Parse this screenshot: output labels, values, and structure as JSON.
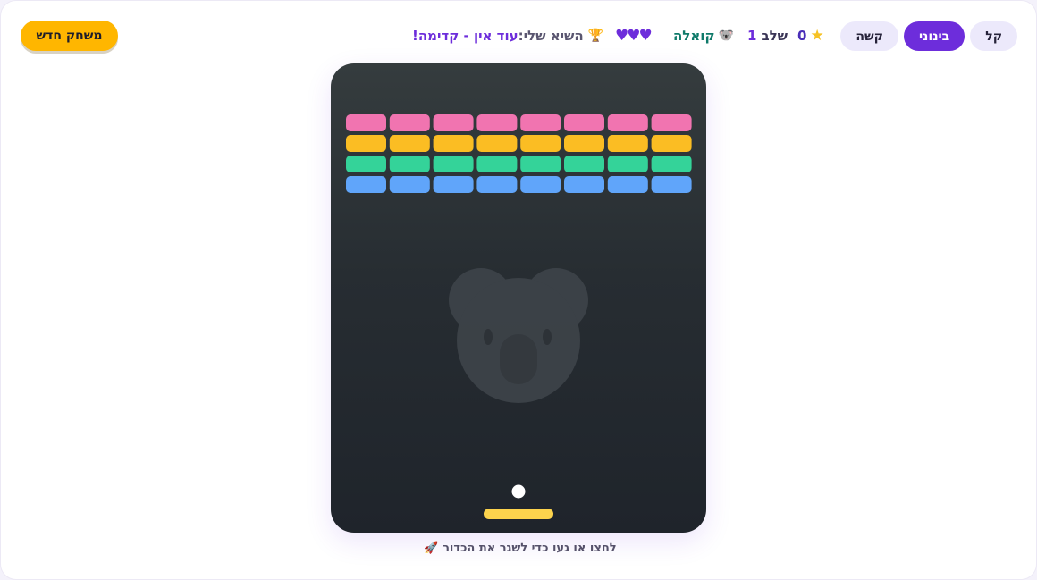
{
  "header": {
    "new_game_label": "משחק חדש",
    "difficulty": [
      {
        "label": "קל",
        "active": false
      },
      {
        "label": "בינוני",
        "active": true
      },
      {
        "label": "קשה",
        "active": false
      }
    ],
    "stars": "0",
    "level_label": "שלב",
    "level_value": "1",
    "animal_name": "קואלה",
    "animal_icon": "koala-icon",
    "lives": "♥♥♥",
    "lives_count": 3,
    "record_label": "השיא שלי:",
    "record_value": "עוד אין - קדימה!"
  },
  "board": {
    "brick_colors": [
      "#f174b0",
      "#fbbd23",
      "#34d399",
      "#60a5fa"
    ],
    "brick_rows": 4,
    "brick_cols": 8,
    "paddle_color": "#fcd34d",
    "ball_color": "#ffffff",
    "watermark_icon": "koala-icon"
  },
  "hint": {
    "text": "לחצו או געו כדי לשגר את הכדור",
    "icon": "rocket-icon"
  }
}
